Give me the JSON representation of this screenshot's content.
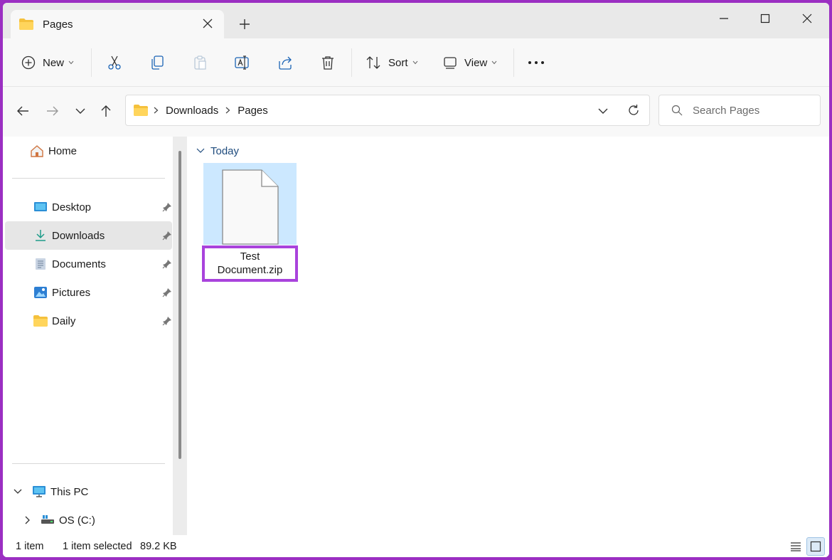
{
  "tab": {
    "title": "Pages"
  },
  "toolbar": {
    "new_label": "New",
    "sort_label": "Sort",
    "view_label": "View"
  },
  "breadcrumb": [
    "Downloads",
    "Pages"
  ],
  "search": {
    "placeholder": "Search Pages"
  },
  "sidebar": {
    "home": "Home",
    "quick_access": [
      {
        "label": "Desktop",
        "icon": "desktop-icon"
      },
      {
        "label": "Downloads",
        "icon": "download-icon",
        "selected": true
      },
      {
        "label": "Documents",
        "icon": "documents-icon"
      },
      {
        "label": "Pictures",
        "icon": "pictures-icon"
      },
      {
        "label": "Daily",
        "icon": "folder-icon"
      }
    ],
    "this_pc": "This PC",
    "drive": "OS (C:)"
  },
  "content": {
    "group": "Today",
    "file": {
      "name_line1": "Test",
      "name_line2": "Document.zip"
    }
  },
  "status": {
    "count": "1 item",
    "selected": "1 item selected",
    "size": "89.2 KB"
  },
  "colors": {
    "frame": "#9b2fc2",
    "highlight": "#a943dc",
    "selection": "#cce8ff"
  }
}
